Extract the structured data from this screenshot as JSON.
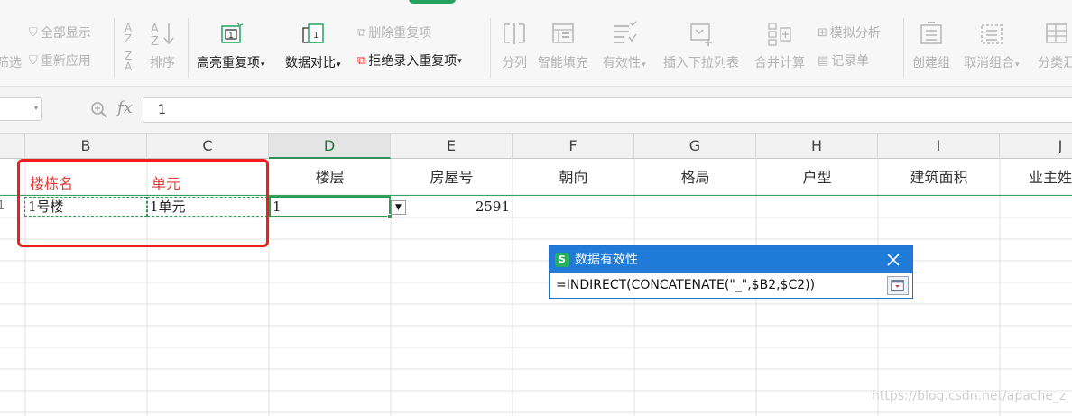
{
  "ribbon": {
    "show_all": "全部显示",
    "reapply": "重新应用",
    "filter_partial": "筛选",
    "sort": "排序",
    "highlight_dup": "高亮重复项",
    "compare": "数据对比",
    "delete_dup": "删除重复项",
    "reject_dup": "拒绝录入重复项",
    "split": "分列",
    "smart_fill": "智能填充",
    "validation": "有效性",
    "insert_dropdown": "插入下拉列表",
    "consolidate": "合并计算",
    "what_if": "模拟分析",
    "record_form": "记录单",
    "create_group": "创建组",
    "ungroup": "取消组合",
    "subtotal_partial": "分类汇"
  },
  "formula_bar": {
    "fx_label": "fx",
    "value": "1"
  },
  "columns": [
    "B",
    "C",
    "D",
    "E",
    "F",
    "G",
    "H",
    "I",
    "J"
  ],
  "row_number_partial": "1",
  "header_row": {
    "B": "楼栋名",
    "C": "单元",
    "D": "楼层",
    "E": "房屋号",
    "F": "朝向",
    "G": "格局",
    "H": "户型",
    "I": "建筑面积",
    "J": "业主姓"
  },
  "data_row": {
    "B": "1号楼",
    "C": "1单元",
    "D": "1",
    "E": "2591"
  },
  "validation_popup": {
    "title": "数据有效性",
    "formula": "=INDIRECT(CONCATENATE(\"_\",$B2,$C2))"
  },
  "watermark": "https://blog.csdn.net/apache_z",
  "colors": {
    "accent_green": "#2e9a56",
    "highlight_red": "#f01d1d",
    "popup_blue": "#1f7bd7"
  }
}
